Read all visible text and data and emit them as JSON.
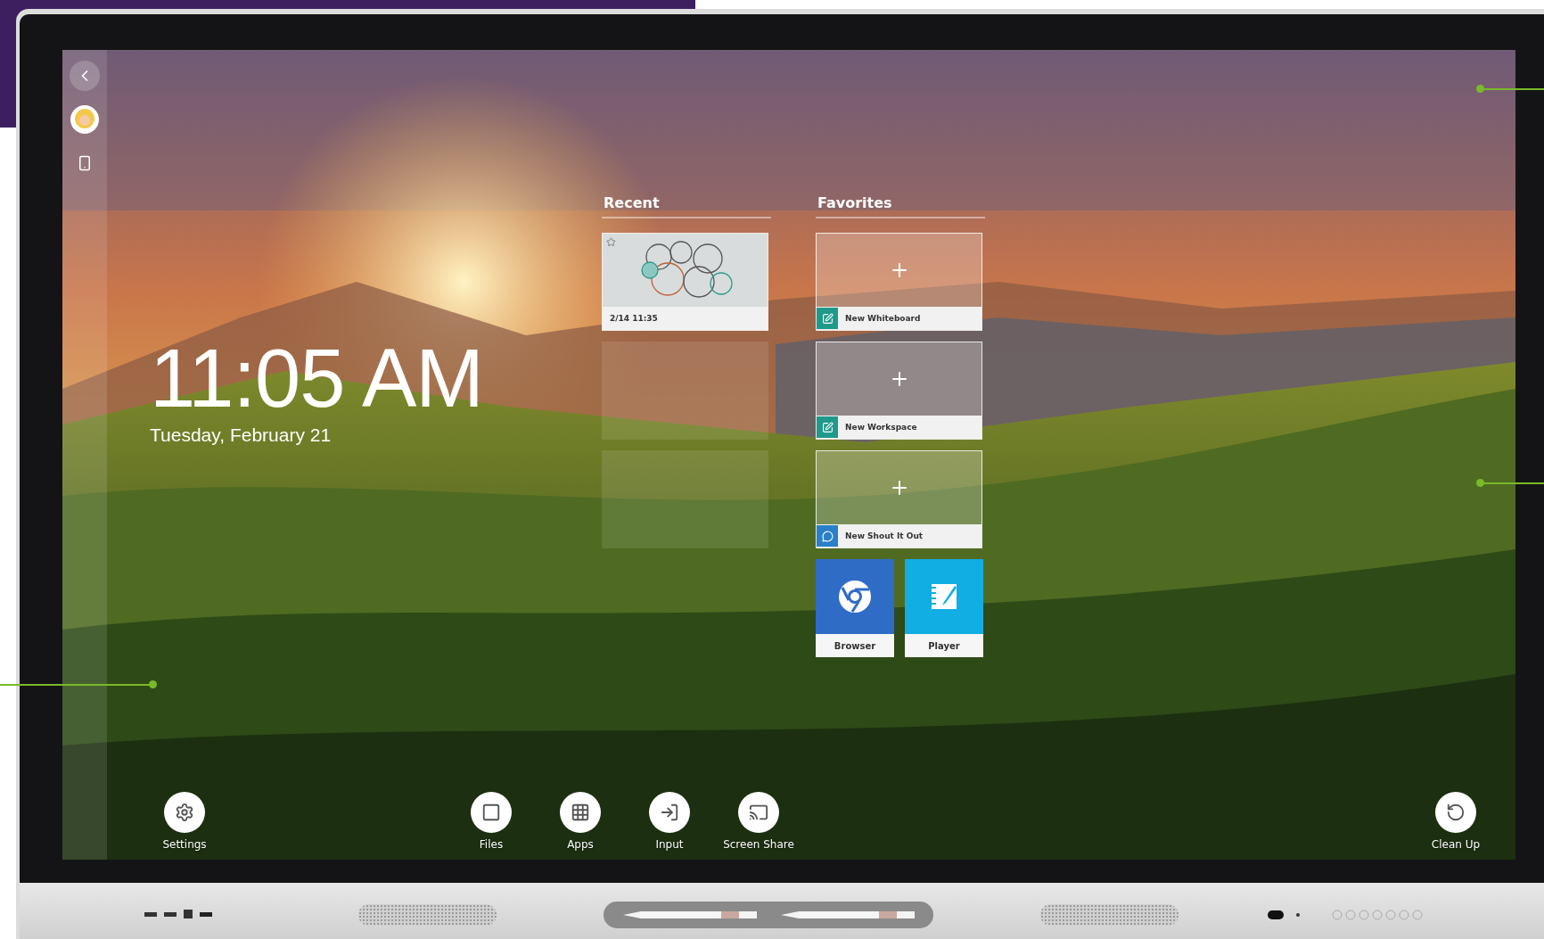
{
  "clock": {
    "time": "11:05 AM",
    "date": "Tuesday, February 21"
  },
  "recent": {
    "title": "Recent",
    "items": [
      {
        "kind": "file",
        "label": "2/14 11:35"
      },
      {
        "kind": "empty"
      },
      {
        "kind": "empty"
      }
    ]
  },
  "favorites": {
    "title": "Favorites",
    "items": [
      {
        "kind": "new",
        "label": "New Whiteboard",
        "color": "#1f9a8a"
      },
      {
        "kind": "new",
        "label": "New Workspace",
        "color": "#1f9a8a"
      },
      {
        "kind": "new",
        "label": "New Shout It Out",
        "color": "#2a7fc9"
      },
      {
        "kind": "app",
        "label": "Browser",
        "color": "#2f6cc6"
      },
      {
        "kind": "app",
        "label": "Player",
        "color": "#10aee3"
      }
    ]
  },
  "dock": {
    "left": [
      {
        "kind": "settings",
        "label": "Settings"
      }
    ],
    "center": [
      {
        "kind": "files",
        "label": "Files"
      },
      {
        "kind": "apps",
        "label": "Apps"
      },
      {
        "kind": "input",
        "label": "Input"
      },
      {
        "kind": "share",
        "label": "Screen Share"
      }
    ],
    "right": [
      {
        "kind": "cleanup",
        "label": "Clean Up"
      }
    ]
  }
}
